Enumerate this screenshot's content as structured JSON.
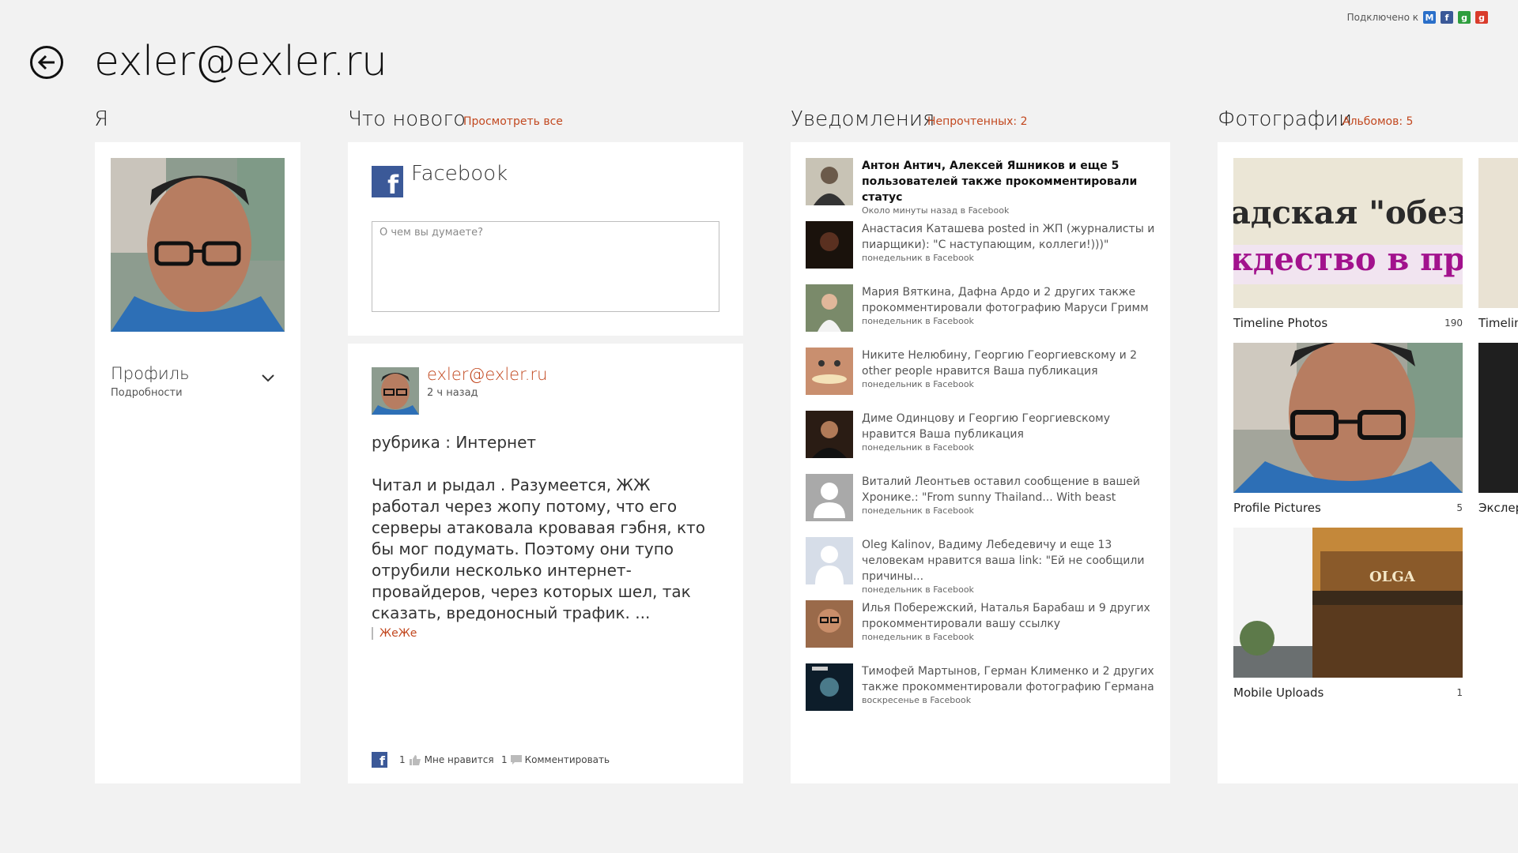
{
  "header": {
    "title": "exler@exler.ru",
    "connected_label": "Подключено к"
  },
  "services": [
    {
      "name": "messenger-icon",
      "letter": "M",
      "color": "#2a6fc9"
    },
    {
      "name": "facebook-icon",
      "letter": "f",
      "color": "#3b5998"
    },
    {
      "name": "google-icon",
      "letter": "g",
      "color": "#2e9e3e"
    },
    {
      "name": "google-icon-2",
      "letter": "g",
      "color": "#d93b2b"
    }
  ],
  "me": {
    "title": "Я",
    "profile_label": "Профиль",
    "profile_sub": "Подробности"
  },
  "news": {
    "title": "Что нового",
    "link": "Просмотреть все",
    "network": "Facebook",
    "compose_placeholder": "О чем вы думаете?",
    "post": {
      "author": "exler@exler.ru",
      "time": "2 ч назад",
      "rubric": "рубрика : Интернет",
      "body": "Читал и рыдал . Разумеется, ЖЖ работал через жопу потому, что его серверы атаковала кровавая гэбня, кто бы мог подумать. Поэтому они тупо отрубили несколько интернет-провайдеров, через которых шел, так сказать, вредоносный трафик. ...",
      "tag": "ЖеЖе",
      "likes": "1",
      "like_label": "Мне нравится",
      "comments": "1",
      "comment_label": "Комментировать"
    }
  },
  "notifications": {
    "title": "Уведомления",
    "link": "Непрочтенных: 2",
    "items": [
      {
        "text": "Антон Антич, Алексей Яшников и еще 5 пользователей также прокомментировали статус",
        "meta": "Около минуты назад в Facebook",
        "unread": true
      },
      {
        "text": "Анастасия Каташева posted in ЖП (журналисты и пиарщики): \"С наступающим, коллеги!)))\"",
        "meta": "понедельник в Facebook",
        "unread": false
      },
      {
        "text": "Мария Вяткина, Дафна Ардо и 2 других также прокомментировали фотографию Маруси Гримм",
        "meta": "понедельник в Facebook",
        "unread": false
      },
      {
        "text": "Никите Нелюбину, Георгию Георгиевскому и 2 other people нравится Ваша публикация",
        "meta": "понедельник в Facebook",
        "unread": false
      },
      {
        "text": "Диме Одинцову и Георгию Георгиевскому нравится Ваша публикация",
        "meta": "понедельник в Facebook",
        "unread": false
      },
      {
        "text": "Виталий Леонтьев оставил сообщение в вашей Хронике.: \"From sunny Thailand... With beast",
        "meta": "понедельник в Facebook",
        "unread": false
      },
      {
        "text": "Oleg Kalinov, Вадиму Лебедевичу и еще 13 человекам нравится ваша link: \"Ей не сообщили причины...",
        "meta": "понедельник в Facebook",
        "unread": false
      },
      {
        "text": "Илья Побережский, Наталья Барабаш и 9 других прокомментировали вашу ссылку",
        "meta": "понедельник в Facebook",
        "unread": false
      },
      {
        "text": "Тимофей Мартынов, Герман Клименко и 2 других также прокомментировали фотографию Германа",
        "meta": "воскресенье в Facebook",
        "unread": false
      }
    ]
  },
  "photos": {
    "title": "Фотографии",
    "link": "Альбомов: 5",
    "albums": [
      {
        "name": "Timeline Photos",
        "count": "190",
        "banner_line1": "адская \"обезь",
        "banner_line2": "кдество в при"
      },
      {
        "name": "Profile Pictures",
        "count": "5"
      },
      {
        "name": "Mobile Uploads",
        "count": "1",
        "sign": "OLGA"
      }
    ],
    "partial_albums": [
      "Timeline",
      "Экслер"
    ]
  }
}
